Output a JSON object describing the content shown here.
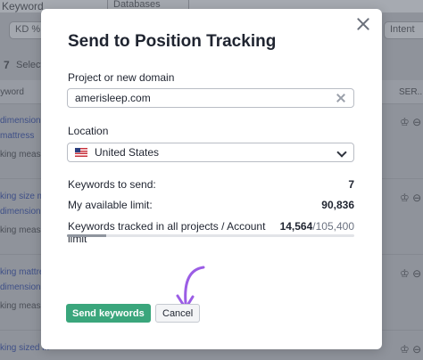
{
  "background": {
    "search_placeholder": "Keyword",
    "databases_label": "Databases",
    "kd_filter": "KD %",
    "intent_filter": "Intent",
    "selected_count": "7",
    "selected_label": "Selected",
    "col_keyword": "Keyword",
    "col_serp": "SER...",
    "row_snippets": [
      "dimensions",
      "mattress",
      "king measure",
      "king size m",
      "dimensions",
      "king measure",
      "king mattre",
      "dimensions",
      "king measure",
      "king sized in"
    ]
  },
  "modal": {
    "title": "Send to Position Tracking",
    "project_label": "Project or new domain",
    "project_value": "amerisleep.com",
    "location_label": "Location",
    "location_value": "United States",
    "keywords_to_send_label": "Keywords to send:",
    "keywords_to_send_value": "7",
    "available_limit_label": "My available limit:",
    "available_limit_value": "90,836",
    "tracked_label": "Keywords tracked in all projects / Account limit",
    "tracked_used": "14,564",
    "tracked_separator": "/",
    "tracked_total": "105,400",
    "tracked_fraction": 0.138,
    "send_button": "Send keywords",
    "cancel_button": "Cancel"
  },
  "colors": {
    "primary_button": "#3aa67c",
    "annotation_arrow": "#9b5de5"
  }
}
